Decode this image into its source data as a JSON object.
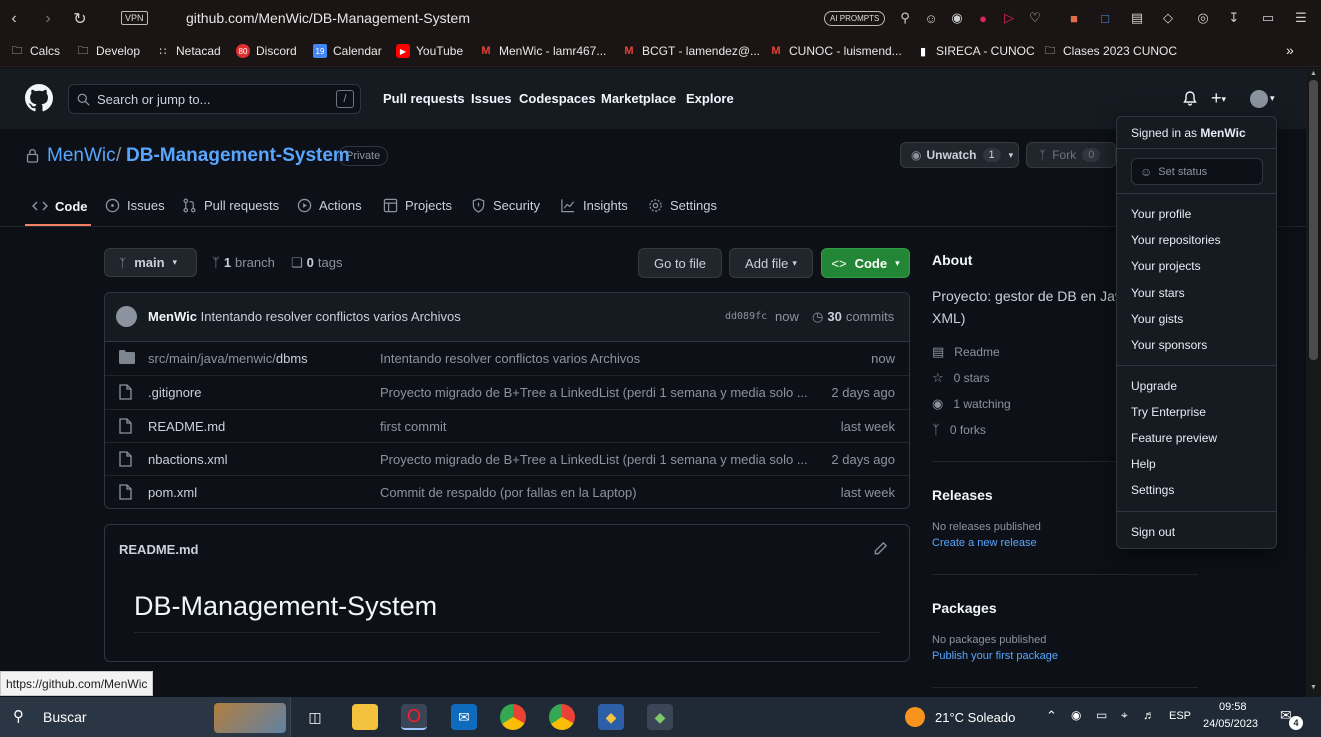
{
  "browser": {
    "url": "github.com/MenWic/DB-Management-System",
    "vpn_label": "VPN",
    "ai_prompts_label": "AI PROMPTS",
    "bookmarks": [
      "Calcs",
      "Develop",
      "Netacad",
      "Discord",
      "Calendar",
      "YouTube",
      "MenWic - lamr467...",
      "BCGT - lamendez@...",
      "CUNOC - luismend...",
      "SIRECA - CUNOC",
      "Clases 2023 CUNOC"
    ],
    "bookmark_overflow": "»",
    "discord_badge": "80",
    "calendar_badge": "19"
  },
  "header": {
    "search_placeholder": "Search or jump to...",
    "search_shortcut": "/",
    "nav": [
      "Pull requests",
      "Issues",
      "Codespaces",
      "Marketplace",
      "Explore"
    ]
  },
  "repo": {
    "owner": "MenWic",
    "separator": "/",
    "name": "DB-Management-System",
    "visibility": "Private",
    "unwatch_label": "Unwatch",
    "watch_count": "1",
    "fork_label": "Fork",
    "fork_count": "0"
  },
  "tabs": [
    "Code",
    "Issues",
    "Pull requests",
    "Actions",
    "Projects",
    "Security",
    "Insights",
    "Settings"
  ],
  "code": {
    "branch": "main",
    "branch_count": "1",
    "branch_label": "branch",
    "tag_count": "0",
    "tag_label": "tags",
    "go_to_file": "Go to file",
    "add_file": "Add file",
    "code_button": "Code",
    "commit_author": "MenWic",
    "commit_message": "Intentando resolver conflictos varios Archivos",
    "commit_hash": "dd089fc",
    "commit_time": "now",
    "commit_count": "30",
    "commit_label": "commits",
    "files": [
      {
        "type": "folder",
        "name_prefix": "src/main/java/menwic/",
        "name": "dbms",
        "message": "Intentando resolver conflictos varios Archivos",
        "date": "now"
      },
      {
        "type": "file",
        "name_prefix": "",
        "name": ".gitignore",
        "message": "Proyecto migrado de B+Tree a LinkedList (perdi 1 semana y media solo ...",
        "date": "2 days ago"
      },
      {
        "type": "file",
        "name_prefix": "",
        "name": "README.md",
        "message": "first commit",
        "date": "last week"
      },
      {
        "type": "file",
        "name_prefix": "",
        "name": "nbactions.xml",
        "message": "Proyecto migrado de B+Tree a LinkedList (perdi 1 semana y media solo ...",
        "date": "2 days ago"
      },
      {
        "type": "file",
        "name_prefix": "",
        "name": "pom.xml",
        "message": "Commit de respaldo (por fallas en la Laptop)",
        "date": "last week"
      }
    ],
    "readme_filename": "README.md",
    "readme_title": "DB-Management-System"
  },
  "about": {
    "heading": "About",
    "description_1": "Proyecto: gestor de DB en Jav",
    "description_2": "XML)",
    "readme": "Readme",
    "stars": "0 stars",
    "watching": "1 watching",
    "forks": "0 forks",
    "releases_heading": "Releases",
    "no_releases": "No releases published",
    "create_release": "Create a new release",
    "packages_heading": "Packages",
    "no_packages": "No packages published",
    "publish_package": "Publish your first package"
  },
  "user_menu": {
    "signed_in_prefix": "Signed in as",
    "username": "MenWic",
    "set_status": "Set status",
    "group1": [
      "Your profile",
      "Your repositories",
      "Your projects",
      "Your stars",
      "Your gists",
      "Your sponsors"
    ],
    "group2": [
      "Upgrade",
      "Try Enterprise",
      "Feature preview",
      "Help",
      "Settings"
    ],
    "sign_out": "Sign out"
  },
  "status_link": "https://github.com/MenWic",
  "taskbar": {
    "search": "Buscar",
    "weather": "21°C  Soleado",
    "lang": "ESP",
    "time": "09:58",
    "date": "24/05/2023",
    "notification_count": "4"
  },
  "colors": {
    "accent_link": "#58a6ff",
    "code_button": "#238636",
    "tab_underline": "#f78166"
  }
}
